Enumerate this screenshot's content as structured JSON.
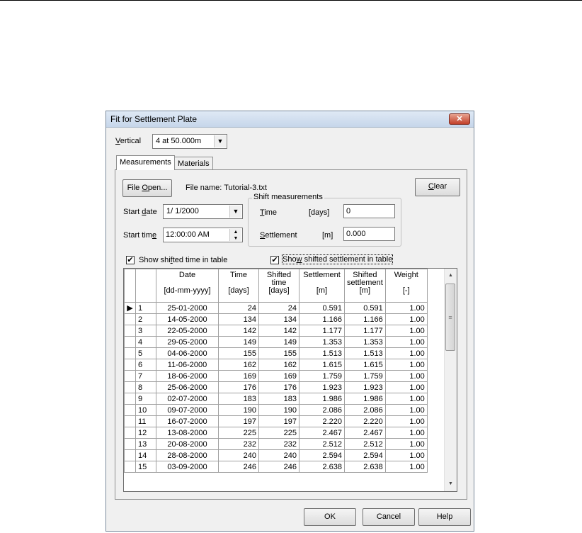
{
  "dialog": {
    "title": "Fit for Settlement Plate",
    "close_icon": "close-icon"
  },
  "vertical": {
    "label": "Vertical",
    "label_accel": "V",
    "label_rest": "ertical",
    "value": "4 at 50.000m"
  },
  "tabs": [
    {
      "label": "Measurements"
    },
    {
      "label": "Materials"
    }
  ],
  "file": {
    "open_button_pre": "File ",
    "open_button_accel": "O",
    "open_button_post": "pen...",
    "file_name": "File name: Tutorial-3.txt"
  },
  "clear_button": {
    "accel": "C",
    "rest": "lear"
  },
  "start_date": {
    "label_pre": "Start ",
    "label_accel": "d",
    "label_post": "ate",
    "value": "1/ 1/2000"
  },
  "start_time": {
    "label_pre": "Start tim",
    "label_accel": "e",
    "value": "12:00:00 AM"
  },
  "shift": {
    "title": "Shift measurements",
    "time_label_accel": "T",
    "time_label_rest": "ime",
    "time_unit": "[days]",
    "time_value": "0",
    "settlement_label_accel": "S",
    "settlement_label_rest": "ettlement",
    "settlement_unit": "[m]",
    "settlement_value": "0.000"
  },
  "options": {
    "show_shifted_time": {
      "pre": "Show shi",
      "accel": "f",
      "post": "ted time in table",
      "checked": true
    },
    "show_shifted_settlement": {
      "pre": "Sho",
      "accel": "w",
      "post": " shifted settlement in table",
      "checked": true
    }
  },
  "table": {
    "headers": [
      [
        "",
        ""
      ],
      [
        "Date",
        "[dd-mm-yyyy]"
      ],
      [
        "Time",
        "[days]"
      ],
      [
        "Shifted time",
        "[days]"
      ],
      [
        "Settlement",
        "[m]"
      ],
      [
        "Shifted settlement",
        "[m]"
      ],
      [
        "Weight",
        "[-]"
      ]
    ],
    "header_lines": [
      [
        "",
        "Date",
        "",
        "[dd-mm-yyyy]"
      ],
      [
        "",
        "Time",
        "",
        "[days]"
      ],
      [
        "Shifted",
        "time",
        "[days]",
        ""
      ],
      [
        "",
        "Settlement",
        "",
        "[m]"
      ],
      [
        "Shifted",
        "settlement",
        "[m]",
        ""
      ],
      [
        "",
        "Weight",
        "",
        "[-]"
      ]
    ],
    "current_row_indicator": "▶",
    "rows": [
      [
        "1",
        "25-01-2000",
        "24",
        "24",
        "0.591",
        "0.591",
        "1.00"
      ],
      [
        "2",
        "14-05-2000",
        "134",
        "134",
        "1.166",
        "1.166",
        "1.00"
      ],
      [
        "3",
        "22-05-2000",
        "142",
        "142",
        "1.177",
        "1.177",
        "1.00"
      ],
      [
        "4",
        "29-05-2000",
        "149",
        "149",
        "1.353",
        "1.353",
        "1.00"
      ],
      [
        "5",
        "04-06-2000",
        "155",
        "155",
        "1.513",
        "1.513",
        "1.00"
      ],
      [
        "6",
        "11-06-2000",
        "162",
        "162",
        "1.615",
        "1.615",
        "1.00"
      ],
      [
        "7",
        "18-06-2000",
        "169",
        "169",
        "1.759",
        "1.759",
        "1.00"
      ],
      [
        "8",
        "25-06-2000",
        "176",
        "176",
        "1.923",
        "1.923",
        "1.00"
      ],
      [
        "9",
        "02-07-2000",
        "183",
        "183",
        "1.986",
        "1.986",
        "1.00"
      ],
      [
        "10",
        "09-07-2000",
        "190",
        "190",
        "2.086",
        "2.086",
        "1.00"
      ],
      [
        "11",
        "16-07-2000",
        "197",
        "197",
        "2.220",
        "2.220",
        "1.00"
      ],
      [
        "12",
        "13-08-2000",
        "225",
        "225",
        "2.467",
        "2.467",
        "1.00"
      ],
      [
        "13",
        "20-08-2000",
        "232",
        "232",
        "2.512",
        "2.512",
        "1.00"
      ],
      [
        "14",
        "28-08-2000",
        "240",
        "240",
        "2.594",
        "2.594",
        "1.00"
      ],
      [
        "15",
        "03-09-2000",
        "246",
        "246",
        "2.638",
        "2.638",
        "1.00"
      ]
    ]
  },
  "buttons": {
    "ok": "OK",
    "cancel": "Cancel",
    "help": "Help"
  }
}
